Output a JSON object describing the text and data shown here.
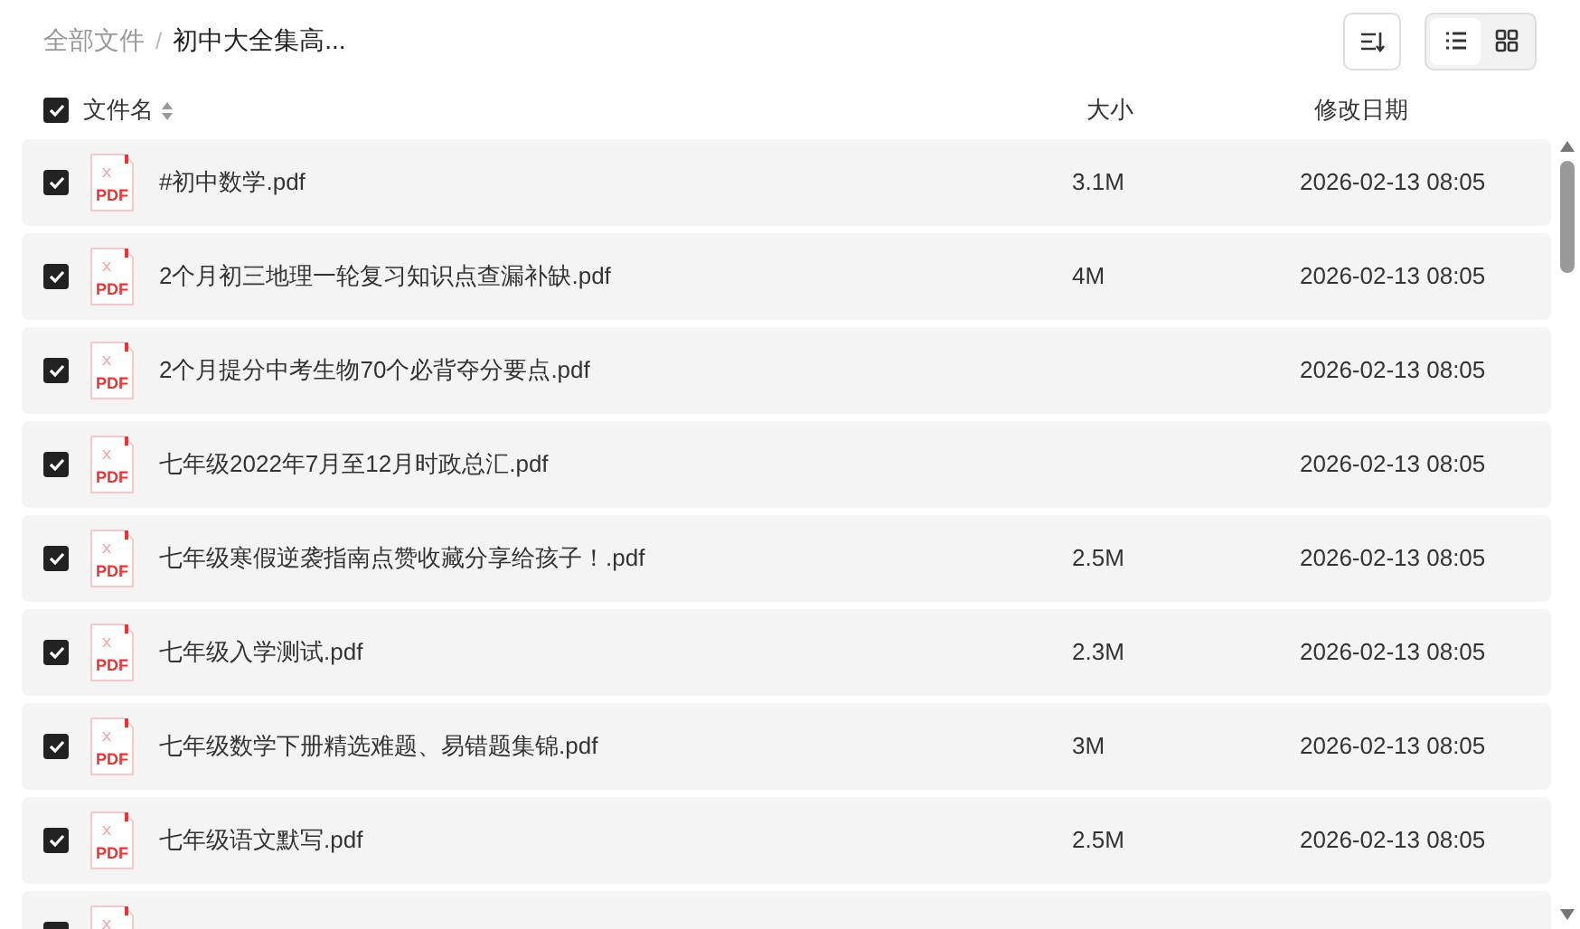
{
  "breadcrumb": [
    {
      "label": "全部文件",
      "current": false
    },
    {
      "label": "初中大全集高...",
      "current": true
    }
  ],
  "breadcrumb_separator": "/",
  "view_modes": [
    {
      "kind": "list",
      "selected": true
    },
    {
      "kind": "grid",
      "selected": false
    }
  ],
  "header": {
    "checked": true,
    "columns": [
      "文件名",
      "大小",
      "修改日期"
    ]
  },
  "files": [
    {
      "icon_label": "PDF",
      "name": "#初中数学.pdf",
      "size": "3.1M",
      "date": "2026-02-13 08:05",
      "checked": true
    },
    {
      "icon_label": "PDF",
      "name": "2个月初三地理一轮复习知识点查漏补缺.pdf",
      "size": "4M",
      "date": "2026-02-13 08:05",
      "checked": true
    },
    {
      "icon_label": "PDF",
      "name": "2个月提分中考生物70个必背夺分要点.pdf",
      "date": "2026-02-13 08:05",
      "checked": true
    },
    {
      "icon_label": "PDF",
      "name": "七年级2022年7月至12月时政总汇.pdf",
      "date": "2026-02-13 08:05",
      "checked": true
    },
    {
      "icon_label": "PDF",
      "name": "七年级寒假逆袭指南点赞收藏分享给孩子！.pdf",
      "size": "2.5M",
      "date": "2026-02-13 08:05",
      "checked": true
    },
    {
      "icon_label": "PDF",
      "name": "七年级入学测试.pdf",
      "size": "2.3M",
      "date": "2026-02-13 08:05",
      "checked": true
    },
    {
      "icon_label": "PDF",
      "name": "七年级数学下册精选难题、易错题集锦.pdf",
      "size": "3M",
      "date": "2026-02-13 08:05",
      "checked": true
    },
    {
      "icon_label": "PDF",
      "name": "七年级语文默写.pdf",
      "size": "2.5M",
      "date": "2026-02-13 08:05",
      "checked": true
    },
    {
      "checked": true
    }
  ]
}
